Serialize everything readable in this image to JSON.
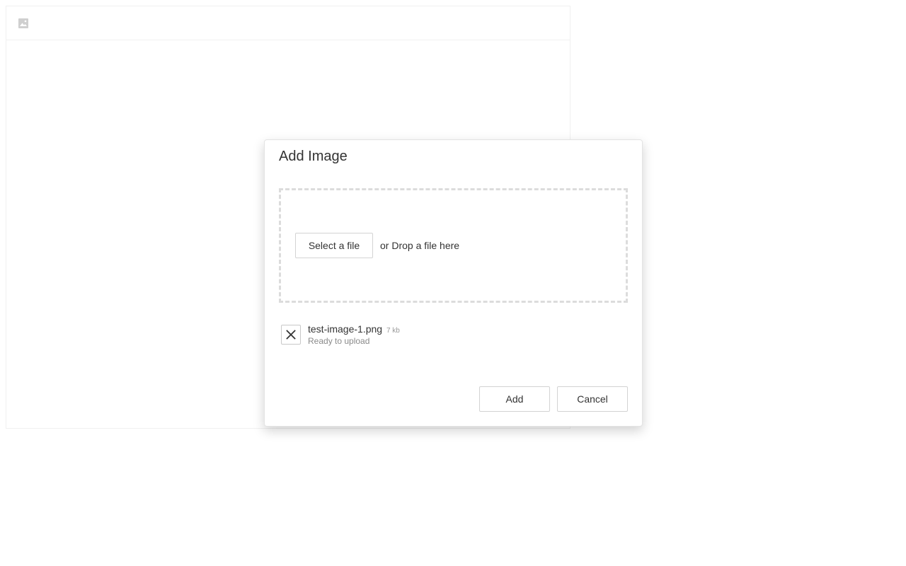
{
  "toolbar": {
    "image_icon": "image-icon"
  },
  "dialog": {
    "title": "Add Image",
    "dropzone": {
      "select_button": "Select a file",
      "drop_text": "or Drop a file here"
    },
    "file": {
      "name": "test-image-1.png",
      "size": "7 kb",
      "status": "Ready to upload",
      "remove_icon": "close-icon"
    },
    "actions": {
      "add": "Add",
      "cancel": "Cancel"
    }
  },
  "colors": {
    "border": "#d3d3d3",
    "dashed_border": "#dcdcdc",
    "muted_text": "#999999",
    "text": "#333333"
  }
}
